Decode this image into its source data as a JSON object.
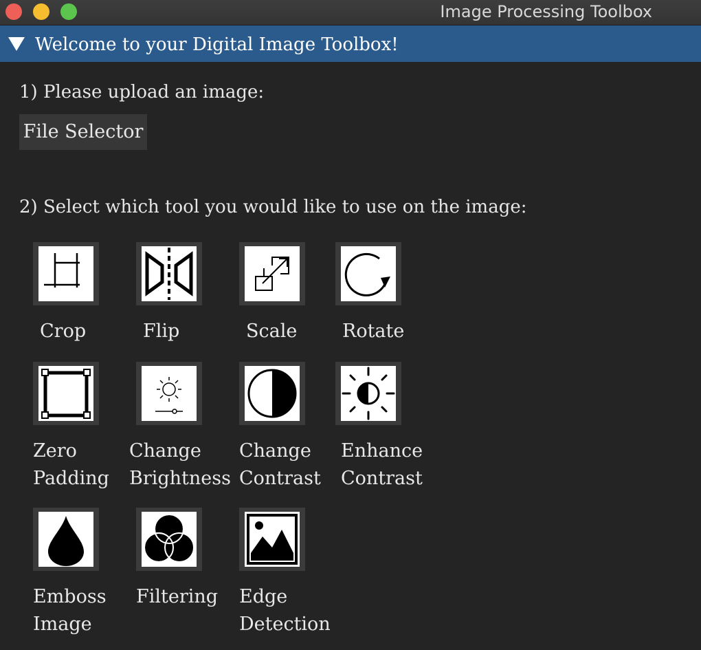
{
  "window": {
    "title": "Image Processing Toolbox"
  },
  "header": {
    "title": "Welcome to your Digital Image Toolbox!"
  },
  "step1": {
    "label": "1) Please upload an image:",
    "button_label": "File Selector"
  },
  "step2": {
    "label": "2) Select which tool you would like to use on the image:"
  },
  "tools": [
    {
      "label": "Crop",
      "icon": "crop-icon"
    },
    {
      "label": "Flip",
      "icon": "flip-icon"
    },
    {
      "label": "Scale",
      "icon": "scale-icon"
    },
    {
      "label": "Rotate",
      "icon": "rotate-icon"
    },
    {
      "label": "Zero\nPadding",
      "icon": "padding-frame-icon"
    },
    {
      "label": "Change\nBrightness",
      "icon": "brightness-slider-icon"
    },
    {
      "label": "Change\nContrast",
      "icon": "contrast-icon"
    },
    {
      "label": "Enhance\nContrast",
      "icon": "sun-contrast-icon"
    },
    {
      "label": "Emboss\nImage",
      "icon": "drop-icon"
    },
    {
      "label": "Filtering",
      "icon": "filter-circles-icon"
    },
    {
      "label": "Edge\nDetection",
      "icon": "image-icon"
    }
  ],
  "colors": {
    "header_bg": "#2b5b8c",
    "panel_bg": "#242424",
    "button_bg": "#3b3b3b"
  }
}
